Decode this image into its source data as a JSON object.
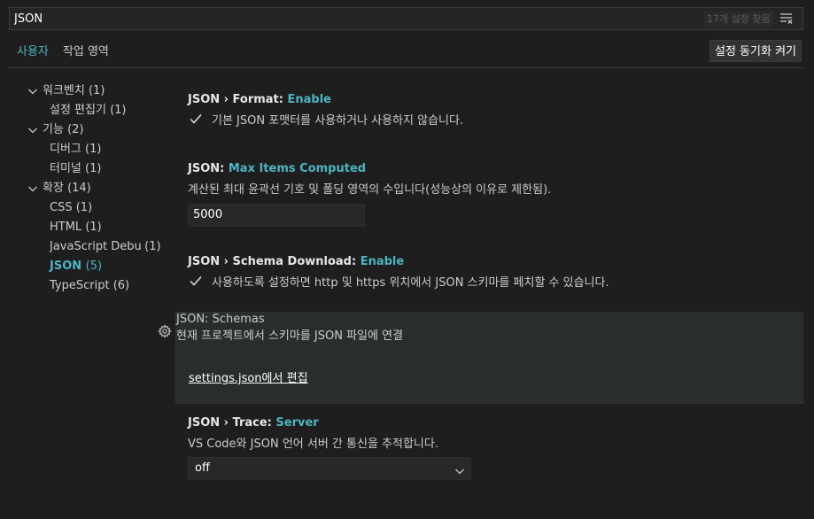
{
  "search": {
    "value": "JSON",
    "count_label": "17개 설정 찾음"
  },
  "tabs": [
    {
      "label": "사용자"
    },
    {
      "label": "작업 영역"
    }
  ],
  "sync_button": "설정 동기화 켜기",
  "toc": {
    "items": [
      {
        "label": "워크벤치",
        "count": "(1)"
      },
      {
        "label": "설정 편집기",
        "count": "(1)"
      },
      {
        "label": "기능",
        "count": "(2)"
      },
      {
        "label": "디버그",
        "count": "(1)"
      },
      {
        "label": "터미널",
        "count": "(1)"
      },
      {
        "label": "확장",
        "count": "(14)"
      },
      {
        "label": "CSS",
        "count": "(1)"
      },
      {
        "label": "HTML",
        "count": "(1)"
      },
      {
        "label": "JavaScript Debu...",
        "count": "(1)"
      },
      {
        "label": "JSON",
        "count": "(5)"
      },
      {
        "label": "TypeScript",
        "count": "(6)"
      }
    ]
  },
  "settings": {
    "format": {
      "title_prefix": "JSON › Format: ",
      "title_key": "Enable",
      "description": "기본 JSON 포맷터를 사용하거나 사용하지 않습니다.",
      "checked": true
    },
    "max_items": {
      "title_prefix": "JSON: ",
      "title_key": "Max Items Computed",
      "description": "계산된 최대 윤곽선 기호 및 폴딩 영역의 수입니다(성능상의 이유로 제한됨).",
      "value": "5000"
    },
    "schema_download": {
      "title_prefix": "JSON › Schema Download: ",
      "title_key": "Enable",
      "description": "사용하도록 설정하면 http 및 https 위치에서 JSON 스키마를 페치할 수 있습니다.",
      "checked": true
    },
    "schemas": {
      "title_prefix": "JSON: ",
      "title_key": "Schemas",
      "description": "현재 프로젝트에서 스키마를 JSON 파일에 연결",
      "link": "settings.json에서 편집"
    },
    "trace": {
      "title_prefix": "JSON › Trace: ",
      "title_key": "Server",
      "description": "VS Code와 JSON 언어 서버 간 통신을 추적합니다.",
      "value": "off"
    }
  },
  "colors": {
    "accent": "#4fb3c2",
    "background": "#1e1e1e",
    "highlight": "#2a2d2e"
  }
}
